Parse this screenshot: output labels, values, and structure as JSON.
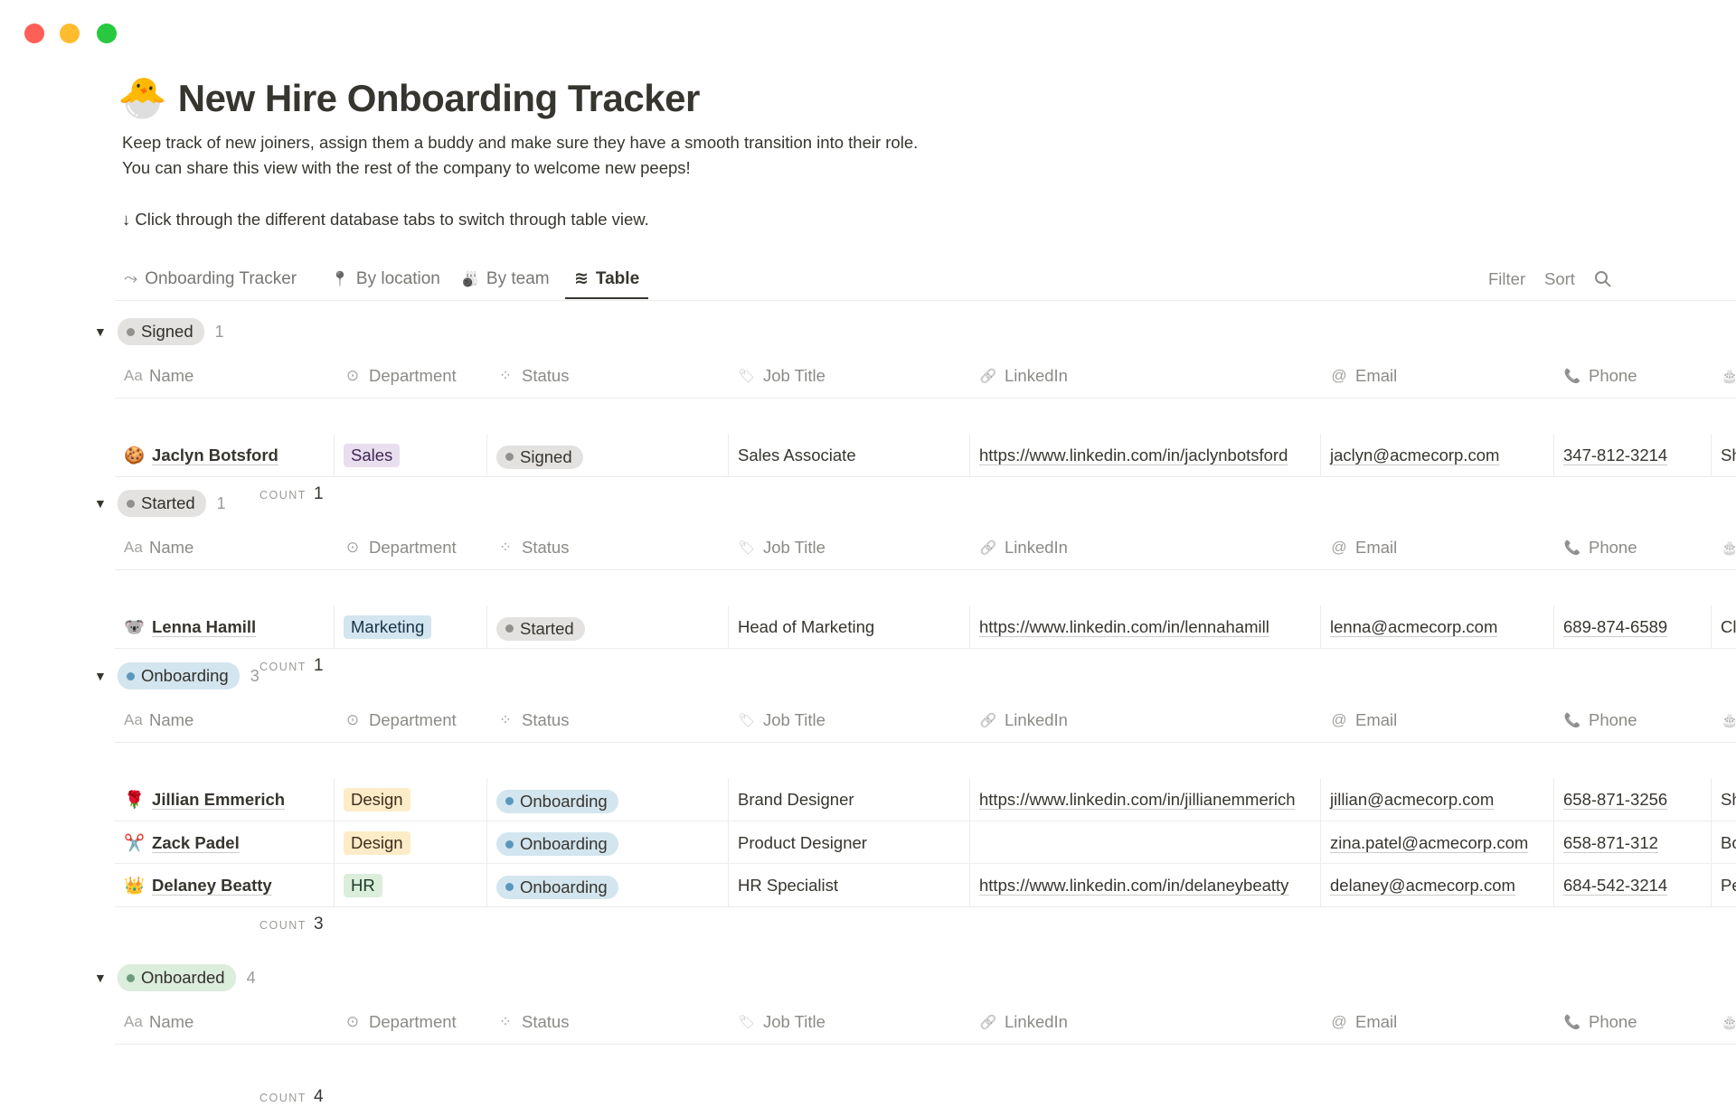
{
  "window": {
    "controls": {
      "close": "#ff5f57",
      "minimize": "#febc2e",
      "zoom": "#28c840"
    }
  },
  "page": {
    "emoji": "🐣",
    "title": "New Hire Onboarding Tracker",
    "description_1": "Keep track of new joiners, assign them a buddy and make sure they have a smooth transition into their role.",
    "description_2": "You can share this view with the rest of the company to welcome new peeps!",
    "instruction": "↓ Click through the different database tabs to switch through table view."
  },
  "tabs": [
    {
      "label": "Onboarding Tracker",
      "icon": "route-icon",
      "glyph": "⤳"
    },
    {
      "label": "By location",
      "icon": "pin-icon",
      "glyph": "📍"
    },
    {
      "label": "By team",
      "icon": "bowling-icon",
      "glyph": "🎳"
    },
    {
      "label": "Table",
      "icon": "wave-icon",
      "glyph": "≋",
      "active": true
    }
  ],
  "toolbar": {
    "filter": "Filter",
    "sort": "Sort",
    "search_icon": "search-icon"
  },
  "columns": [
    {
      "label": "Name",
      "icon": "text-icon",
      "glyph": "Aa"
    },
    {
      "label": "Department",
      "icon": "select-icon",
      "glyph": "⊙"
    },
    {
      "label": "Status",
      "icon": "status-icon",
      "glyph": "⁘"
    },
    {
      "label": "Job Title",
      "icon": "tag-icon",
      "glyph": "🏷"
    },
    {
      "label": "LinkedIn",
      "icon": "link-icon",
      "glyph": "🔗"
    },
    {
      "label": "Email",
      "icon": "at-icon",
      "glyph": "@"
    },
    {
      "label": "Phone",
      "icon": "phone-icon",
      "glyph": "📞"
    },
    {
      "label": "",
      "icon": "cake-icon",
      "glyph": "🎂"
    }
  ],
  "count_label": "COUNT",
  "colors": {
    "Sales": {
      "bg": "#e8deee",
      "fg": "#412454"
    },
    "Marketing": {
      "bg": "#d3e5ef",
      "fg": "#183347"
    },
    "Design": {
      "bg": "#fdecc8",
      "fg": "#402c1b"
    },
    "HR": {
      "bg": "#dbeddb",
      "fg": "#1c3829"
    },
    "Signed": {
      "bg": "#e3e2e0",
      "dot": "#91918e"
    },
    "Started": {
      "bg": "#e3e2e0",
      "dot": "#91918e"
    },
    "Onboarding": {
      "bg": "#d3e5ef",
      "dot": "#5b97bd"
    },
    "Onboarded": {
      "bg": "#dbeddb",
      "dot": "#6c9b7d"
    }
  },
  "groups": [
    {
      "label": "Signed",
      "count": "1",
      "footer_count": "1",
      "rows": [
        {
          "emoji": "🍪",
          "name": "Jaclyn Botsford",
          "department": "Sales",
          "status": "Signed",
          "job_title": "Sales Associate",
          "linkedin": "https://www.linkedin.com/in/jaclynbotsford",
          "email": "jaclyn@acmecorp.com",
          "phone": "347-812-3214",
          "extra": "Sh"
        }
      ]
    },
    {
      "label": "Started",
      "count": "1",
      "footer_count": "1",
      "rows": [
        {
          "emoji": "🐨",
          "name": "Lenna Hamill",
          "department": "Marketing",
          "status": "Started",
          "job_title": "Head of Marketing",
          "linkedin": "https://www.linkedin.com/in/lennahamill",
          "email": "lenna@acmecorp.com",
          "phone": "689-874-6589",
          "extra": "Cl"
        }
      ]
    },
    {
      "label": "Onboarding",
      "count": "3",
      "footer_count": "3",
      "rows": [
        {
          "emoji": "🌹",
          "name": "Jillian Emmerich",
          "department": "Design",
          "status": "Onboarding",
          "job_title": "Brand Designer",
          "linkedin": "https://www.linkedin.com/in/jillianemmerich",
          "email": "jillian@acmecorp.com",
          "phone": "658-871-3256",
          "extra": "Sh"
        },
        {
          "emoji": "✂️",
          "name": "Zack Padel",
          "department": "Design",
          "status": "Onboarding",
          "job_title": "Product Designer",
          "linkedin": "",
          "email": "zina.patel@acmecorp.com",
          "phone": "658-871-312",
          "extra": "Bo De"
        },
        {
          "emoji": "👑",
          "name": "Delaney Beatty",
          "department": "HR",
          "status": "Onboarding",
          "job_title": "HR Specialist",
          "linkedin": "https://www.linkedin.com/in/delaneybeatty",
          "email": "delaney@acmecorp.com",
          "phone": "684-542-3214",
          "extra": "Pe"
        }
      ]
    },
    {
      "label": "Onboarded",
      "count": "4",
      "footer_count": "4",
      "rows": []
    }
  ]
}
